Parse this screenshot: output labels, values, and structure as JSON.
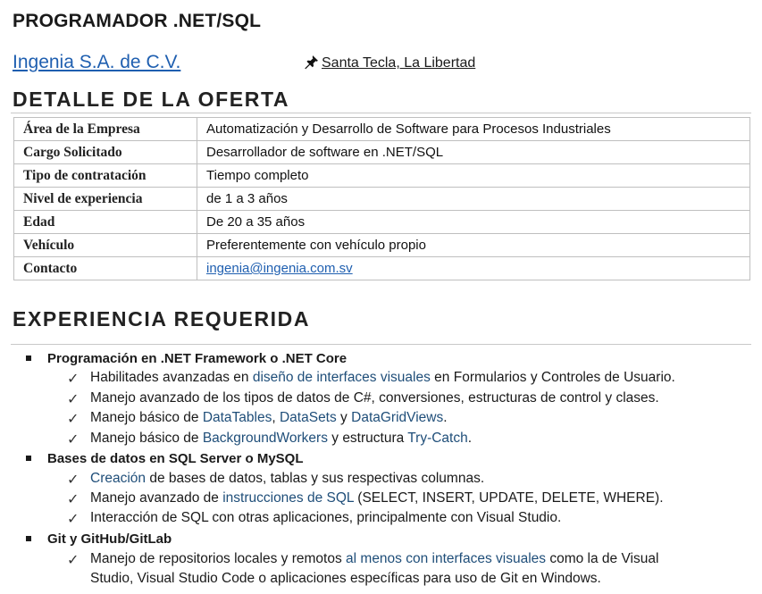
{
  "job": {
    "title": "PROGRAMADOR .NET/SQL",
    "company": "Ingenia S.A. de C.V.",
    "location": "Santa Tecla, La Libertad",
    "location_icon": "pushpin-icon"
  },
  "detail": {
    "heading": "DETALLE DE LA OFERTA",
    "rows": [
      {
        "label": "Área de la Empresa",
        "value": "Automatización y Desarrollo de Software para Procesos Industriales"
      },
      {
        "label": "Cargo Solicitado",
        "value": "Desarrollador de software en .NET/SQL"
      },
      {
        "label": "Tipo de contratación",
        "value": "Tiempo completo"
      },
      {
        "label": "Nivel de experiencia",
        "value": "de 1 a 3 años"
      },
      {
        "label": "Edad",
        "value": "De 20 a 35 años"
      },
      {
        "label": "Vehículo",
        "value": "Preferentemente con vehículo propio"
      },
      {
        "label": "Contacto",
        "value": "ingenia@ingenia.com.sv"
      }
    ]
  },
  "experience": {
    "heading": "EXPERIENCIA REQUERIDA",
    "groups": [
      {
        "title": "Programación en .NET Framework o .NET Core",
        "items": [
          [
            "Habilitades avanzadas en ",
            "diseño de interfaces visuales",
            " en Formularios y Controles de Usuario."
          ],
          [
            "Manejo avanzado de los tipos de datos de C#, conversiones, estructuras de control y clases."
          ],
          [
            "Manejo básico de ",
            "DataTables",
            ", ",
            "DataSets",
            " y ",
            "DataGridViews",
            "."
          ],
          [
            "Manejo básico de ",
            "BackgroundWorkers",
            " y estructura ",
            "Try-Catch",
            "."
          ]
        ]
      },
      {
        "title": "Bases de datos en SQL Server o MySQL",
        "items": [
          [
            "Creación",
            " de bases de datos, tablas y sus respectivas columnas."
          ],
          [
            "Manejo avanzado de ",
            "instrucciones de SQL",
            " (SELECT, INSERT, UPDATE, DELETE, WHERE)."
          ],
          [
            "Interacción de SQL con otras aplicaciones, principalmente con Visual Studio."
          ]
        ]
      },
      {
        "title": "Git y GitHub/GitLab",
        "items": [
          [
            "Manejo de repositorios locales y remotos ",
            "al menos con interfaces visuales",
            " como la de Visual"
          ],
          [
            "Studio, Visual Studio Code o aplicaciones específicas para uso de Git en Windows."
          ]
        ]
      }
    ]
  },
  "colors": {
    "link": "#1f5fb0",
    "highlight": "#1f4e79",
    "rule": "#c8c8c8"
  }
}
